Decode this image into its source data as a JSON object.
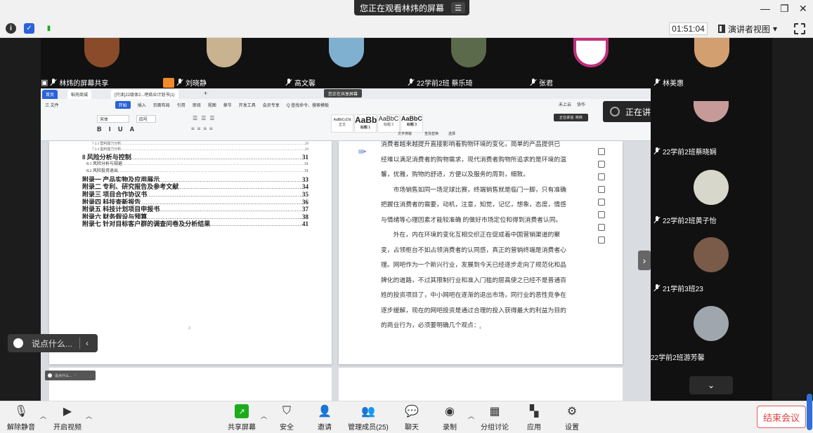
{
  "banner": {
    "text": "您正在观看林炜的屏幕",
    "menu_icon": "menu-icon"
  },
  "window": {
    "minimize": "—",
    "restore": "❐",
    "close": "✕"
  },
  "info": {
    "timer": "01:51:04",
    "view_label": "演讲者视图",
    "view_caret": "▾"
  },
  "participants_top": [
    {
      "name": "林炜的屏幕共享",
      "color": "#b06a3a"
    },
    {
      "name": "刘晓静",
      "color": "#c9b28f"
    },
    {
      "name": "高文馨",
      "color": "#7fb0d0"
    },
    {
      "name": "22学前2班 蔡乐琦",
      "color": "#5a6a4a"
    },
    {
      "name": "张君",
      "color": "#c0307a"
    },
    {
      "name": "林美惠",
      "color": "#d2a070"
    }
  ],
  "participants_right": [
    {
      "name": "22学前2班蔡晓娴",
      "color": "#c79a9a"
    },
    {
      "name": "22学前2班黄子怡",
      "color": "#d7d7cc"
    },
    {
      "name": "21学前3班23",
      "color": "#7a5a48"
    },
    {
      "name": "22学前2班游芳馨",
      "color": "#a0a6ad"
    }
  ],
  "speaker_panel": {
    "label": "正在讲话: 林炜;"
  },
  "wps": {
    "tabs": [
      "首页",
      "稻壳商城",
      "[只读]22级体2...吧商业计划书(1)"
    ],
    "sharing_badge": "您正在共享屏幕",
    "menu": [
      "三 文件",
      "开始",
      "插入",
      "页面布局",
      "引用",
      "审阅",
      "视图",
      "章节",
      "开发工具",
      "会员专享",
      "Q 查找命令、搜索模板"
    ],
    "menu_right": [
      "未上云",
      "协作"
    ],
    "speaking_mini": "正在讲话: 林炜",
    "font_name": "宋体",
    "font_size": "四号",
    "styles": [
      {
        "sample": "AaBbCcDd",
        "name": "正文"
      },
      {
        "sample": "AaBb",
        "name": "标题 1"
      },
      {
        "sample": "AaBbC",
        "name": "标题 2"
      },
      {
        "sample": "AaBbC",
        "name": "标题 3"
      }
    ],
    "ribbon_labels": [
      "文字排版",
      "查找替换",
      "选择"
    ]
  },
  "toc": [
    {
      "level": "tiny",
      "text": "7.3.3 营利能力分析",
      "page": "29"
    },
    {
      "level": "tiny",
      "text": "7.3.4 盈利能力分析",
      "page": "29"
    },
    {
      "level": "big",
      "text": "8  风险分析与控制",
      "page": "31"
    },
    {
      "level": "small",
      "text": "8.1  风险分析与规避",
      "page": "31"
    },
    {
      "level": "small",
      "text": "8.2  风险投资退出",
      "page": "31"
    },
    {
      "level": "big",
      "text": "附录一  产品实物及应用展示",
      "page": "33"
    },
    {
      "level": "big",
      "text": "附录二  专利、研究报告及参考文献",
      "page": "34"
    },
    {
      "level": "big",
      "text": "附录三  项目合作协议书",
      "page": "35"
    },
    {
      "level": "big",
      "text": "附录四  科技查新报告",
      "page": "36"
    },
    {
      "level": "big",
      "text": "附录五  科技计划项目申报书",
      "page": "37"
    },
    {
      "level": "big",
      "text": "附录六  财务假设与预算",
      "page": "38"
    },
    {
      "level": "big",
      "text": "附录七  针对目标客户群的调查问卷及分析结果",
      "page": "41"
    }
  ],
  "page_numbers": {
    "left": "3",
    "right": "4"
  },
  "body_lines": [
    "消费者越来越提升直接影响着购物环境的变化，简单的产品提供已",
    "经难以满足消费者的购物需求，现代消费者购物所追求的是环境的温",
    "馨，优雅，购物的舒适，方便以及服务的周到，细致。",
    "　　市场销售如同一场足球比赛，终端销售就是临门一脚，只有准确",
    "把握住消费者的需要，动机，注意，知觉，记忆，想象，态度，情感",
    "与情绪等心理因素才能较准确 的做好市场定位和得到消费者认同。",
    "　　外在，内在环境的变化互相交织正在促成着中国营销渠道的聚",
    "变，占领柜台不如占领消费者的认同感，真正的营销终端是消费者心",
    "理。网吧作为一个新兴行业，发展到今天已经逐步走向了规范化和品",
    "牌化的道路，不过其限制行业和准入门槛的层高使之已经不是普通百",
    "姓的投资项目了，中小网吧在逐渐的退出市场，同行业的恶性竞争在",
    "逐步缓解，现在的网吧投资是通过合理的投入获得最大的利益为目的",
    "的商业行为，必须要明确几个观点："
  ],
  "chat": {
    "placeholder": "说点什么...",
    "collapse": "‹"
  },
  "toolbar": {
    "mute": "解除静音",
    "video": "开启视频",
    "share": "共享屏幕",
    "security": "安全",
    "invite": "邀请",
    "members": "管理成员(25)",
    "chat": "聊天",
    "record": "录制",
    "breakout": "分组讨论",
    "apps": "应用",
    "settings": "设置",
    "end": "结束会议"
  },
  "colors": {
    "accent": "#2b62d9",
    "end_red": "#e04040",
    "share_green": "#1aad19"
  }
}
